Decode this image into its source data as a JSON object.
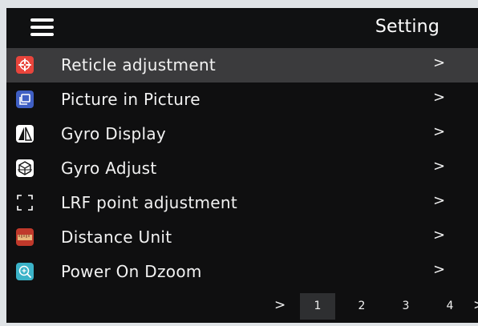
{
  "header": {
    "title": "Setting",
    "menu_icon": "hamburger-menu-icon"
  },
  "menu": {
    "items": [
      {
        "label": "Reticle adjustment",
        "icon": "reticle-icon",
        "chevron": ">",
        "selected": true
      },
      {
        "label": "Picture in Picture",
        "icon": "picture-in-picture-icon",
        "chevron": ">"
      },
      {
        "label": "Gyro Display",
        "icon": "gyro-display-icon",
        "chevron": ">"
      },
      {
        "label": "Gyro Adjust",
        "icon": "gyro-adjust-icon",
        "chevron": ">"
      },
      {
        "label": "LRF point adjustment",
        "icon": "lrf-point-icon",
        "chevron": ">"
      },
      {
        "label": "Distance Unit",
        "icon": "ruler-icon",
        "chevron": ">"
      },
      {
        "label": "Power On Dzoom",
        "icon": "zoom-icon",
        "chevron": ">"
      }
    ]
  },
  "pager": {
    "next": ">",
    "pages": [
      "1",
      "2",
      "3",
      "4"
    ],
    "active": "1",
    "more": ">"
  },
  "colors": {
    "background": "#0f0f10",
    "selected_row": "#3b3b3d",
    "reticle_icon": "#e8453c",
    "pip_icon": "#3f5fc4",
    "ruler_icon": "#c0392b",
    "zoom_icon": "#3bb3c8"
  }
}
